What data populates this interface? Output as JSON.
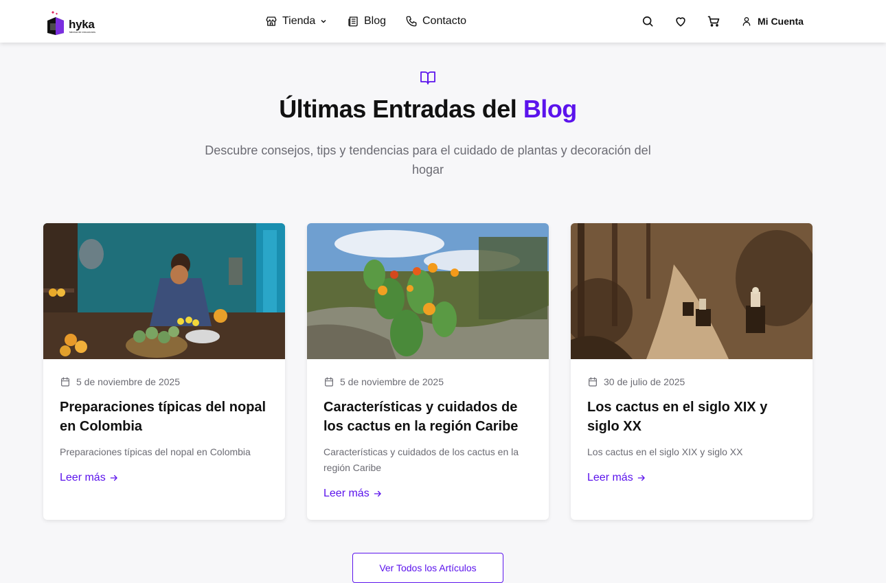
{
  "brand": {
    "name": "hyka",
    "tagline": "fabrica de emociones",
    "accent_color": "#5b13ec"
  },
  "nav": {
    "tienda": {
      "label": "Tienda",
      "icon": "store-icon"
    },
    "blog": {
      "label": "Blog",
      "icon": "newspaper-icon"
    },
    "contacto": {
      "label": "Contacto",
      "icon": "phone-icon"
    }
  },
  "header_icons": [
    "search-icon",
    "heart-icon",
    "cart-icon",
    "user-icon"
  ],
  "account": {
    "label": "Mi Cuenta"
  },
  "hero": {
    "title_main": "Últimas Entradas del ",
    "title_accent": "Blog",
    "subtitle": "Descubre consejos, tips y tendencias para el cuidado de plantas y decoración del hogar"
  },
  "posts": [
    {
      "date": "5 de noviembre de 2025",
      "title": "Preparaciones típicas del nopal en Colombia",
      "excerpt": "Preparaciones típicas del nopal en Colombia",
      "link": "Leer más"
    },
    {
      "date": "5 de noviembre de 2025",
      "title": "Características y cuidados de los cactus en la región Caribe",
      "excerpt": "Características y cuidados de los cactus en la región Caribe",
      "link": "Leer más"
    },
    {
      "date": "30 de julio de 2025",
      "title": "Los cactus en el siglo XIX y siglo XX",
      "excerpt": "Los cactus en el siglo XIX y siglo XX",
      "link": "Leer más"
    }
  ],
  "view_all": "Ver Todos los Artículos"
}
